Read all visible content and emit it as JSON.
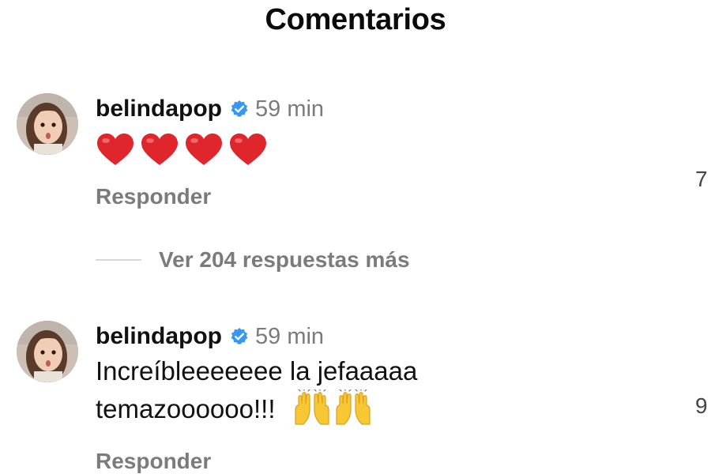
{
  "header": {
    "title": "Comentarios"
  },
  "comments": [
    {
      "username": "belindapop",
      "verified": true,
      "time": "59 min",
      "body_emoji": [
        "heart-emoji",
        "heart-emoji",
        "heart-emoji",
        "heart-emoji"
      ],
      "reply_label": "Responder",
      "likes": "7"
    },
    {
      "username": "belindapop",
      "verified": true,
      "time": "59 min",
      "text_line1": "Increíbleeeeeee la jefaaaaa",
      "text_line2": "temazoooooo!!!",
      "body_emoji": [
        "raising-hands-emoji",
        "raising-hands-emoji"
      ],
      "reply_label": "Responder",
      "likes": "9"
    }
  ],
  "thread": {
    "view_replies_label": "Ver 204 respuestas más"
  },
  "colors": {
    "verified_badge": "#3897f0",
    "heart": "#e0262d",
    "secondary_text": "#7b7b7b"
  }
}
